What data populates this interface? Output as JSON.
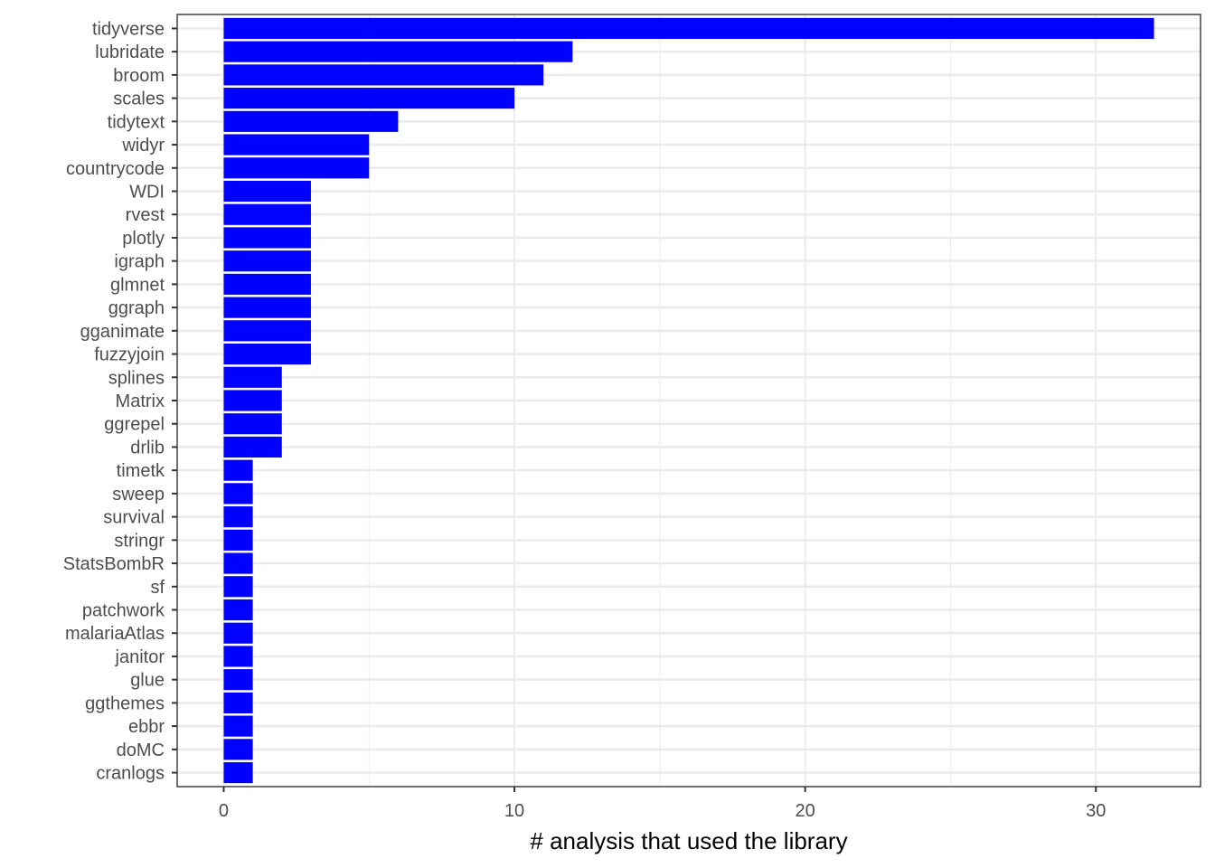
{
  "chart_data": {
    "type": "bar",
    "orientation": "horizontal",
    "title": "",
    "xlabel": "# analysis that used the library",
    "ylabel": "",
    "xlim": [
      -1.6,
      33.6
    ],
    "x_ticks": [
      0,
      10,
      20,
      30
    ],
    "x_minor_ticks": [
      5,
      15,
      25
    ],
    "grid": true,
    "legend": "none",
    "bar_color": "#0000FF",
    "categories": [
      "tidyverse",
      "lubridate",
      "broom",
      "scales",
      "tidytext",
      "widyr",
      "countrycode",
      "WDI",
      "rvest",
      "plotly",
      "igraph",
      "glmnet",
      "ggraph",
      "gganimate",
      "fuzzyjoin",
      "splines",
      "Matrix",
      "ggrepel",
      "drlib",
      "timetk",
      "sweep",
      "survival",
      "stringr",
      "StatsBombR",
      "sf",
      "patchwork",
      "malariaAtlas",
      "janitor",
      "glue",
      "ggthemes",
      "ebbr",
      "doMC",
      "cranlogs"
    ],
    "values": [
      32,
      12,
      11,
      10,
      6,
      5,
      5,
      3,
      3,
      3,
      3,
      3,
      3,
      3,
      3,
      2,
      2,
      2,
      2,
      1,
      1,
      1,
      1,
      1,
      1,
      1,
      1,
      1,
      1,
      1,
      1,
      1,
      1
    ]
  }
}
